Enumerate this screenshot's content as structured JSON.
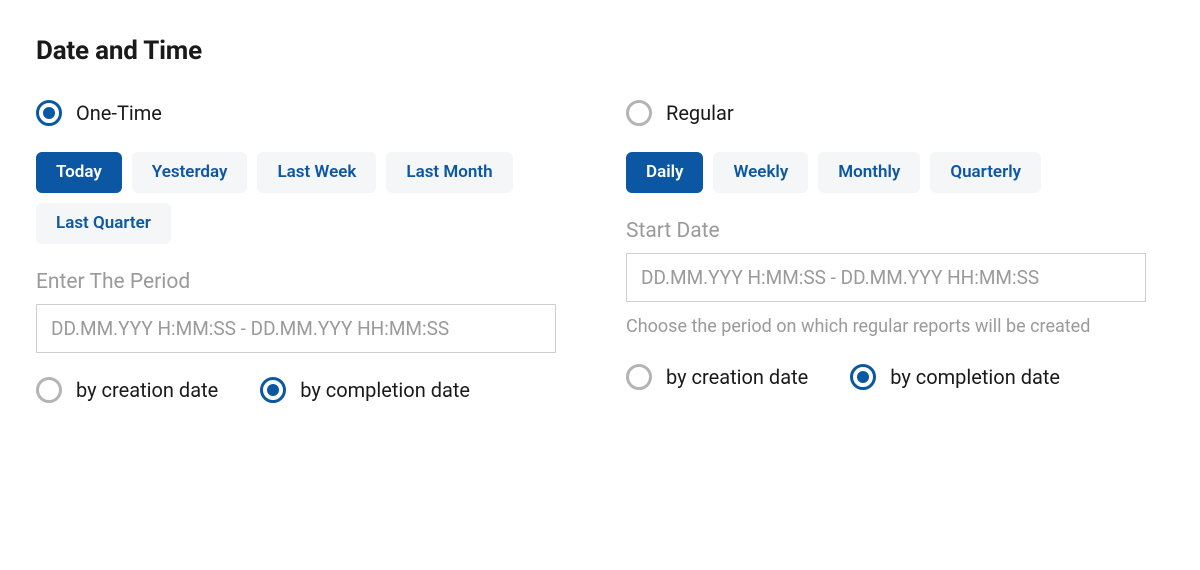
{
  "title": "Date and Time",
  "left": {
    "mode": {
      "label": "One-Time",
      "selected": true
    },
    "chips": [
      {
        "label": "Today",
        "active": true
      },
      {
        "label": "Yesterday",
        "active": false
      },
      {
        "label": "Last Week",
        "active": false
      },
      {
        "label": "Last Month",
        "active": false
      },
      {
        "label": "Last Quarter",
        "active": false
      }
    ],
    "period_label": "Enter The Period",
    "period_placeholder": "DD.MM.YYY H:MM:SS - DD.MM.YYY HH:MM:SS",
    "by_creation": {
      "label": "by creation date",
      "selected": false
    },
    "by_completion": {
      "label": "by completion date",
      "selected": true
    }
  },
  "right": {
    "mode": {
      "label": "Regular",
      "selected": false
    },
    "chips": [
      {
        "label": "Daily",
        "active": true
      },
      {
        "label": "Weekly",
        "active": false
      },
      {
        "label": "Monthly",
        "active": false
      },
      {
        "label": "Quarterly",
        "active": false
      }
    ],
    "start_label": "Start Date",
    "start_placeholder": "DD.MM.YYY H:MM:SS - DD.MM.YYY HH:MM:SS",
    "hint": "Choose the period on which regular reports will be created",
    "by_creation": {
      "label": "by creation date",
      "selected": false
    },
    "by_completion": {
      "label": "by completion date",
      "selected": true
    }
  }
}
